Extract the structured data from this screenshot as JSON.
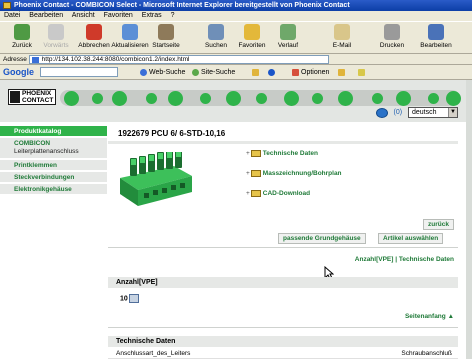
{
  "window": {
    "title": "Phoenix Contact - COMBICON Select - Microsoft Internet Explorer bereitgestellt von Phoenix Contact"
  },
  "menu": [
    "Datei",
    "Bearbeiten",
    "Ansicht",
    "Favoriten",
    "Extras",
    "?"
  ],
  "toolbar": {
    "back": "Zurück",
    "forward": "Vorwärts",
    "stop": "Abbrechen",
    "refresh": "Aktualisieren",
    "home": "Startseite",
    "search": "Suchen",
    "favorites": "Favoriten",
    "history": "Verlauf",
    "mail": "E-Mail",
    "print": "Drucken",
    "edit": "Bearbeiten"
  },
  "address": {
    "label": "Adresse",
    "url": "http://134.102.38.244:8080/combicon1.2/index.html"
  },
  "googlebar": {
    "logo": "Google",
    "web_search": "Web-Suche",
    "site_search": "Site-Suche",
    "options": "Optionen"
  },
  "header": {
    "logo_line1": "PHOENIX",
    "logo_line2": "CONTACT",
    "cart_count": "(0)",
    "language": "deutsch"
  },
  "sidebar": {
    "items": [
      {
        "label": "Produktkatalog",
        "sub": ""
      },
      {
        "label": "COMBICON",
        "sub": "Leiterplattenanschluss"
      },
      {
        "label": "Printklemmen",
        "sub": ""
      },
      {
        "label": "Steckverbindungen",
        "sub": ""
      },
      {
        "label": "Elektronikgehäuse",
        "sub": ""
      }
    ]
  },
  "product": {
    "title": "1922679 PCU 6/ 6-STD-10,16",
    "links": [
      "Technische Daten",
      "Masszeichnung/Bohrplan",
      "CAD-Download"
    ],
    "back_button": "zurück",
    "housing_button": "passende Grundgehäuse",
    "select_button": "Artikel auswählen",
    "anchor_links": "Anzahl[VPE] | Technische Daten",
    "section_vpe": "Anzahl[VPE]",
    "vpe_value": "10",
    "top_link": "Seitenanfang",
    "section_tech": "Technische Daten",
    "tech_rows": [
      {
        "label": "Anschlussart_des_Leiters",
        "value": "Schraubanschluß"
      }
    ]
  },
  "colors": {
    "brand_green": "#2fb34a",
    "link_green": "#1f7a38",
    "panel_gray": "#e6e8e6"
  }
}
